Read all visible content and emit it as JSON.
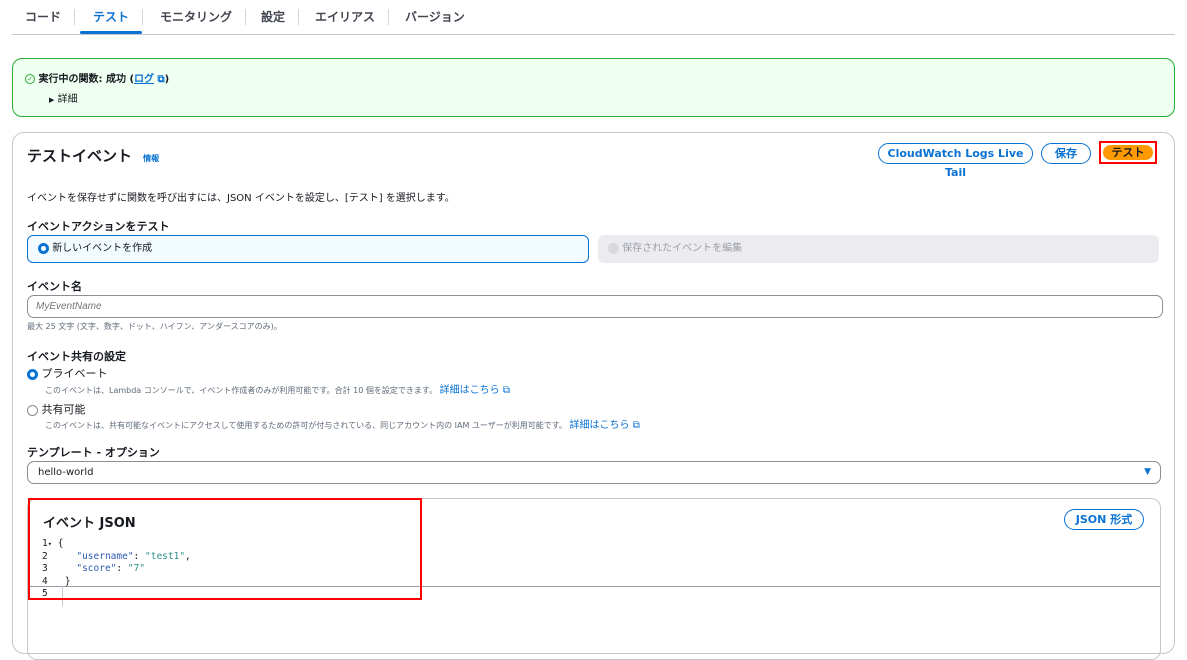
{
  "tabs": [
    {
      "label": "コード"
    },
    {
      "label": "テスト",
      "active": true
    },
    {
      "label": "モニタリング"
    },
    {
      "label": "設定"
    },
    {
      "label": "エイリアス"
    },
    {
      "label": "バージョン"
    }
  ],
  "banner": {
    "status": "実行中の関数: 成功 (",
    "log_link": "ログ",
    "close": ")",
    "details": "詳細",
    "icon": "check-circle-icon"
  },
  "panel": {
    "title": "テストイベント",
    "info": "情報",
    "buttons": {
      "live_tail": "CloudWatch Logs Live Tail",
      "save": "保存",
      "test": "テスト"
    },
    "description": "イベントを保存せずに関数を呼び出すには、JSON イベントを設定し、[テスト] を選択します。",
    "action_label": "イベントアクションをテスト",
    "action_options": [
      {
        "label": "新しいイベントを作成",
        "selected": true
      },
      {
        "label": "保存されたイベントを編集",
        "disabled": true
      }
    ],
    "event_name_label": "イベント名",
    "event_name_placeholder": "MyEventName",
    "event_name_hint": "最大 25 文字 (文字、数字、ドット、ハイフン、アンダースコアのみ)。",
    "sharing_label": "イベント共有の設定",
    "sharing_options": [
      {
        "label": "プライベート",
        "selected": true,
        "desc": "このイベントは、Lambda コンソールで、イベント作成者のみが利用可能です。合計 10 個を設定できます。",
        "link": "詳細はこちら"
      },
      {
        "label": "共有可能",
        "selected": false,
        "desc": "このイベントは、共有可能なイベントにアクセスして使用するための許可が付与されている、同じアカウント内の IAM ユーザーが利用可能です。",
        "link": "詳細はこちら"
      }
    ],
    "template_label": "テンプレート - オプション",
    "template_value": "hello-world",
    "json": {
      "title": "イベント JSON",
      "format_button": "JSON 形式",
      "lines": [
        {
          "n": "1",
          "text": "{"
        },
        {
          "n": "2",
          "key": "\"username\"",
          "val": "\"test1\"",
          "end": ","
        },
        {
          "n": "3",
          "key": "\"score\"",
          "val": "\"7\"",
          "end": ""
        },
        {
          "n": "4",
          "text": "}"
        },
        {
          "n": "5",
          "text": ""
        }
      ]
    }
  },
  "colors": {
    "accent": "#0972d3",
    "primary_button": "#ff9900",
    "highlight": "#ff0000",
    "success": "#29ad32"
  }
}
